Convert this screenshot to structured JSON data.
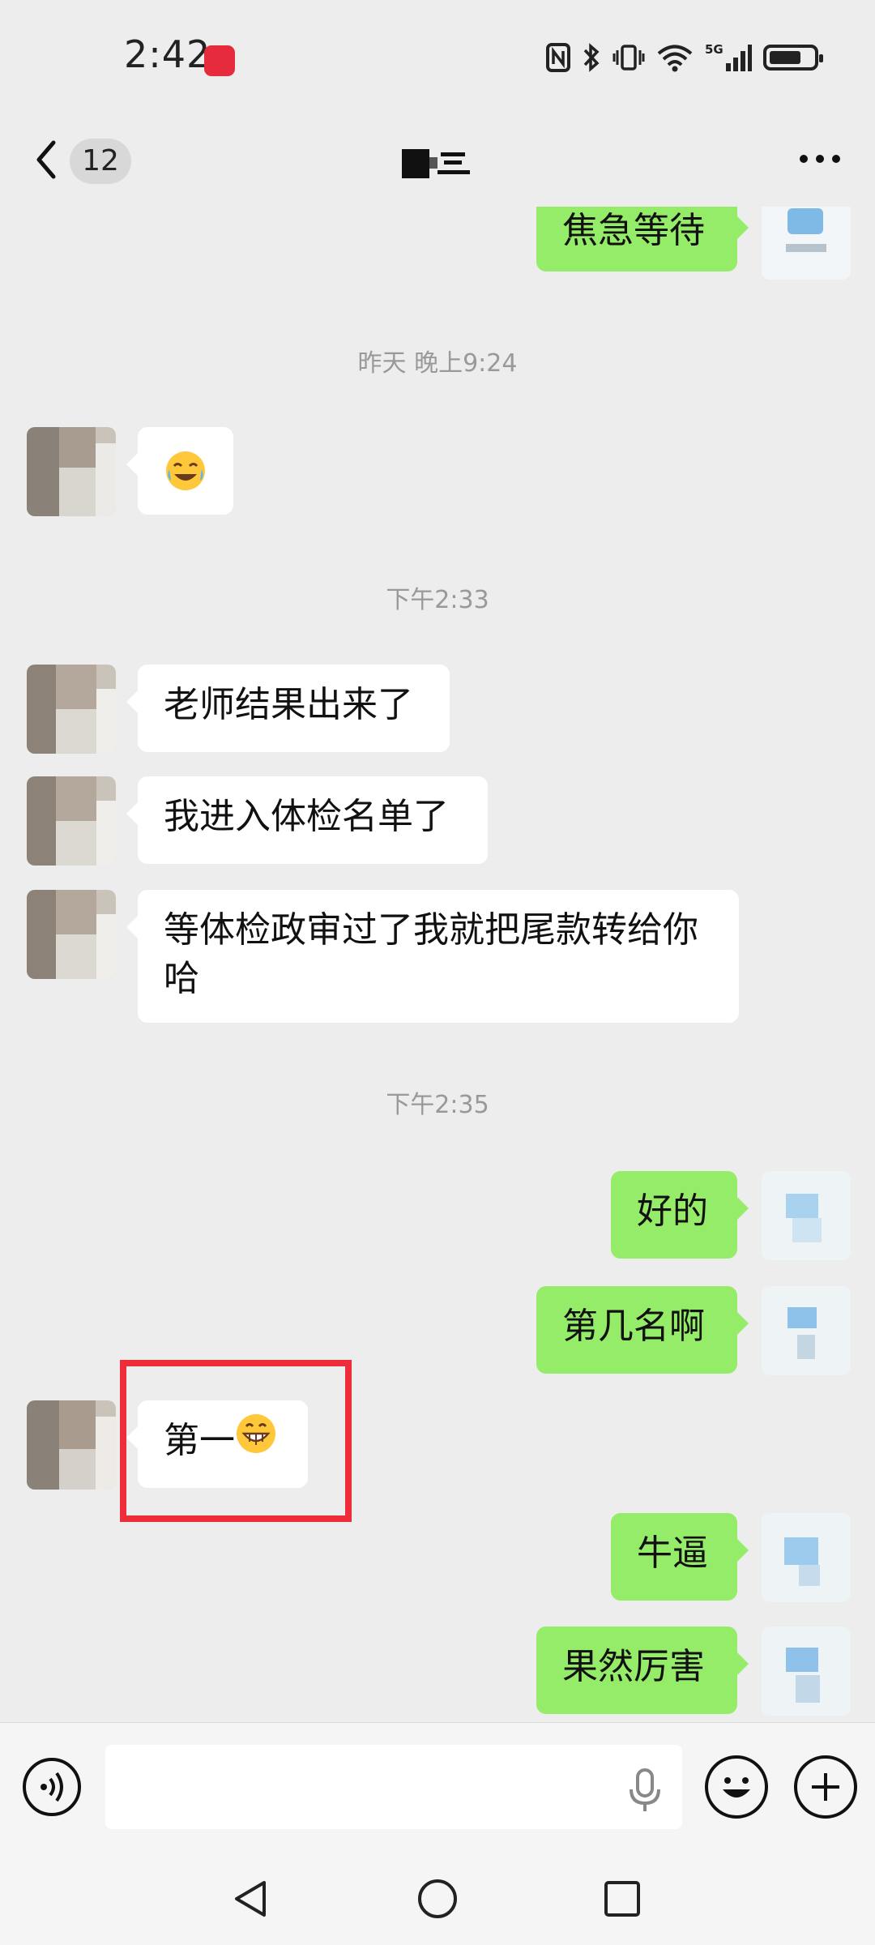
{
  "status_bar": {
    "time": "2:42",
    "icons": [
      "nfc-icon",
      "bluetooth-icon",
      "vibrate-icon",
      "wifi-icon",
      "signal-5g-icon",
      "battery-icon"
    ],
    "network": "5G"
  },
  "header": {
    "unread_count": "12",
    "title": "",
    "more_label": "···"
  },
  "messages": [
    {
      "side": "out",
      "type": "text",
      "text": "焦急等待"
    },
    {
      "type": "timestamp",
      "text": "昨天 晚上9:24"
    },
    {
      "side": "in",
      "type": "emoji",
      "emoji": "laughing-crying-emoji"
    },
    {
      "type": "timestamp",
      "text": "下午2:33"
    },
    {
      "side": "in",
      "type": "text",
      "text": "老师结果出来了"
    },
    {
      "side": "in",
      "type": "text",
      "text": "我进入体检名单了"
    },
    {
      "side": "in",
      "type": "text",
      "text": "等体检政审过了我就把尾款转给你哈"
    },
    {
      "type": "timestamp",
      "text": "下午2:35"
    },
    {
      "side": "out",
      "type": "text",
      "text": "好的"
    },
    {
      "side": "out",
      "type": "text",
      "text": "第几名啊"
    },
    {
      "side": "in",
      "type": "text",
      "text": "第一",
      "emoji": "grin-emoji",
      "highlighted": true
    },
    {
      "side": "out",
      "type": "text",
      "text": "牛逼"
    },
    {
      "side": "out",
      "type": "text",
      "text": "果然厉害"
    }
  ],
  "input_bar": {
    "placeholder": "",
    "value": ""
  },
  "colors": {
    "background": "#ededed",
    "incoming_bubble": "#ffffff",
    "outgoing_bubble": "#95ec69",
    "highlight_box": "#ee2c3a",
    "timestamp": "#999999"
  }
}
